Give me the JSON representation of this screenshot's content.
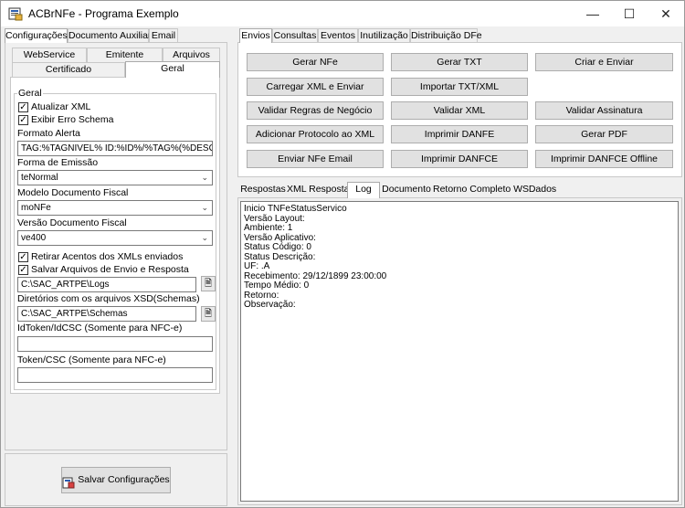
{
  "window": {
    "title": "ACBrNFe - Programa Exemplo",
    "minimize_icon": "minimize-icon",
    "maximize_icon": "maximize-icon",
    "close_icon": "close-icon"
  },
  "left_tabs": [
    "Configurações",
    "Documento Auxiliar",
    "Email"
  ],
  "config_tabs_row1": [
    "WebService",
    "Emitente",
    "Arquivos"
  ],
  "config_tabs_row2": [
    "Certificado",
    "Geral"
  ],
  "geral": {
    "group_label": "Geral",
    "atualizar_xml": {
      "label": "Atualizar XML",
      "checked": true
    },
    "exibir_erro": {
      "label": "Exibir Erro Schema",
      "checked": true
    },
    "formato_alerta_label": "Formato Alerta",
    "formato_alerta_value": "TAG:%TAGNIVEL% ID:%ID%/%TAG%(%DESCRI",
    "forma_emissao_label": "Forma de Emissão",
    "forma_emissao_value": "teNormal",
    "modelo_label": "Modelo Documento Fiscal",
    "modelo_value": "moNFe",
    "versao_label": "Versão Documento Fiscal",
    "versao_value": "ve400",
    "retirar_acentos": {
      "label": "Retirar Acentos dos XMLs enviados",
      "checked": true
    },
    "salvar_arquivos": {
      "label": "Salvar Arquivos de Envio e Resposta",
      "checked": true
    },
    "logs_path": "C:\\SAC_ARTPE\\Logs",
    "schemas_label": "Diretórios com os arquivos XSD(Schemas)",
    "schemas_path": "C:\\SAC_ARTPE\\Schemas",
    "idtoken_label": "IdToken/IdCSC (Somente para NFC-e)",
    "idtoken_value": "",
    "token_label": "Token/CSC (Somente para NFC-e)",
    "token_value": ""
  },
  "save_button": "Salvar Configurações",
  "right_tabs": [
    "Envios",
    "Consultas",
    "Eventos",
    "Inutilização",
    "Distribuição DFe"
  ],
  "action_buttons": [
    [
      "Gerar NFe",
      "Gerar TXT",
      "Criar e Enviar"
    ],
    [
      "Carregar XML e Enviar",
      "Importar TXT/XML",
      ""
    ],
    [
      "Validar Regras de Negócio",
      "Validar XML",
      "Validar Assinatura"
    ],
    [
      "Adicionar Protocolo ao XML",
      "Imprimir DANFE",
      "Gerar PDF"
    ],
    [
      "Enviar NFe Email",
      "Imprimir DANFCE",
      "Imprimir DANFCE Offline"
    ]
  ],
  "result_tabs": [
    "Respostas",
    "XML Resposta",
    "Log",
    "Documento",
    "Retorno Completo WS",
    "Dados"
  ],
  "log_lines": [
    "Inicio TNFeStatusServico",
    "Versão Layout:",
    "Ambiente: 1",
    "Versão Aplicativo:",
    "Status Código: 0",
    "Status Descrição:",
    "UF: .A",
    "Recebimento: 29/12/1899 23:00:00",
    "Tempo Médio: 0",
    "Retorno:",
    "Observação:"
  ]
}
